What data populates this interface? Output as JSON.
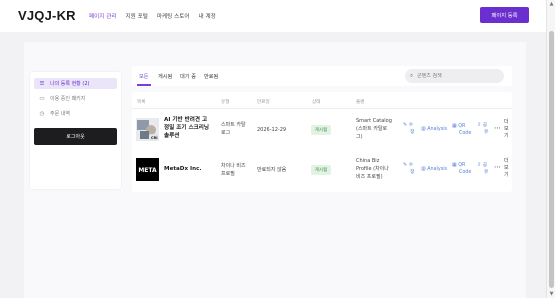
{
  "header": {
    "logo": "VJQJ-KR",
    "nav": [
      "페이지 관리",
      "지원 포털",
      "마케팅 스토어",
      "내 계정"
    ],
    "active_nav": "페이지 관리",
    "register_button": "페이지 등록"
  },
  "sidebar": {
    "items": [
      {
        "label": "나의 등록 현황 (2)",
        "icon": "list-icon",
        "active": true
      },
      {
        "label": "이용 중인 패키지",
        "icon": "card-icon",
        "active": false
      },
      {
        "label": "주문 내역",
        "icon": "clock-icon",
        "active": false
      }
    ],
    "logout": "로그아웃"
  },
  "tabs": [
    "모든",
    "게시됨",
    "대기 중",
    "만료됨"
  ],
  "active_tab": "모든",
  "search": {
    "placeholder": "콘텐츠 검색"
  },
  "table": {
    "headers": [
      "목록",
      "유형",
      "만료일",
      "상태",
      "플랜"
    ],
    "rows": [
      {
        "title_lines": [
          "AI 기반 반려견 고",
          "정밀 조기 스크리닝",
          "솔루션"
        ],
        "type_lines": [
          "스마트 카탈",
          "로그"
        ],
        "expiry": "2026-12-29",
        "status": "게시됨",
        "plan_lines": [
          "Smart Catalog",
          "(스마트 카탈로",
          "그)"
        ],
        "actions": {
          "edit": [
            "수",
            "정"
          ],
          "analysis": "Analysis",
          "qr": [
            "QR",
            "Code"
          ],
          "share": [
            "공",
            "유"
          ],
          "more": [
            "더",
            "보",
            "기"
          ]
        },
        "thumbnail": "ai-dog-screening-thumbnail"
      },
      {
        "title_lines": [
          "MetaDx Inc."
        ],
        "type_lines": [
          "차이나 비즈",
          "프로필"
        ],
        "expiry": "만료되지 않음",
        "status": "게시됨",
        "plan_lines": [
          "China Biz",
          "Profile (차이나",
          "비즈 프로필)"
        ],
        "actions": {
          "edit": [
            "수",
            "정"
          ],
          "analysis": "Analysis",
          "qr": [
            "QR",
            "Code"
          ],
          "share": [
            "공",
            "유"
          ],
          "more": [
            "더",
            "보",
            "기"
          ]
        },
        "thumbnail": "metadx-logo"
      }
    ]
  },
  "colors": {
    "accent": "#6b2fd0",
    "status_bg": "#e2f3e4",
    "status_text": "#3f8c4b",
    "link": "#5a7fd8"
  }
}
